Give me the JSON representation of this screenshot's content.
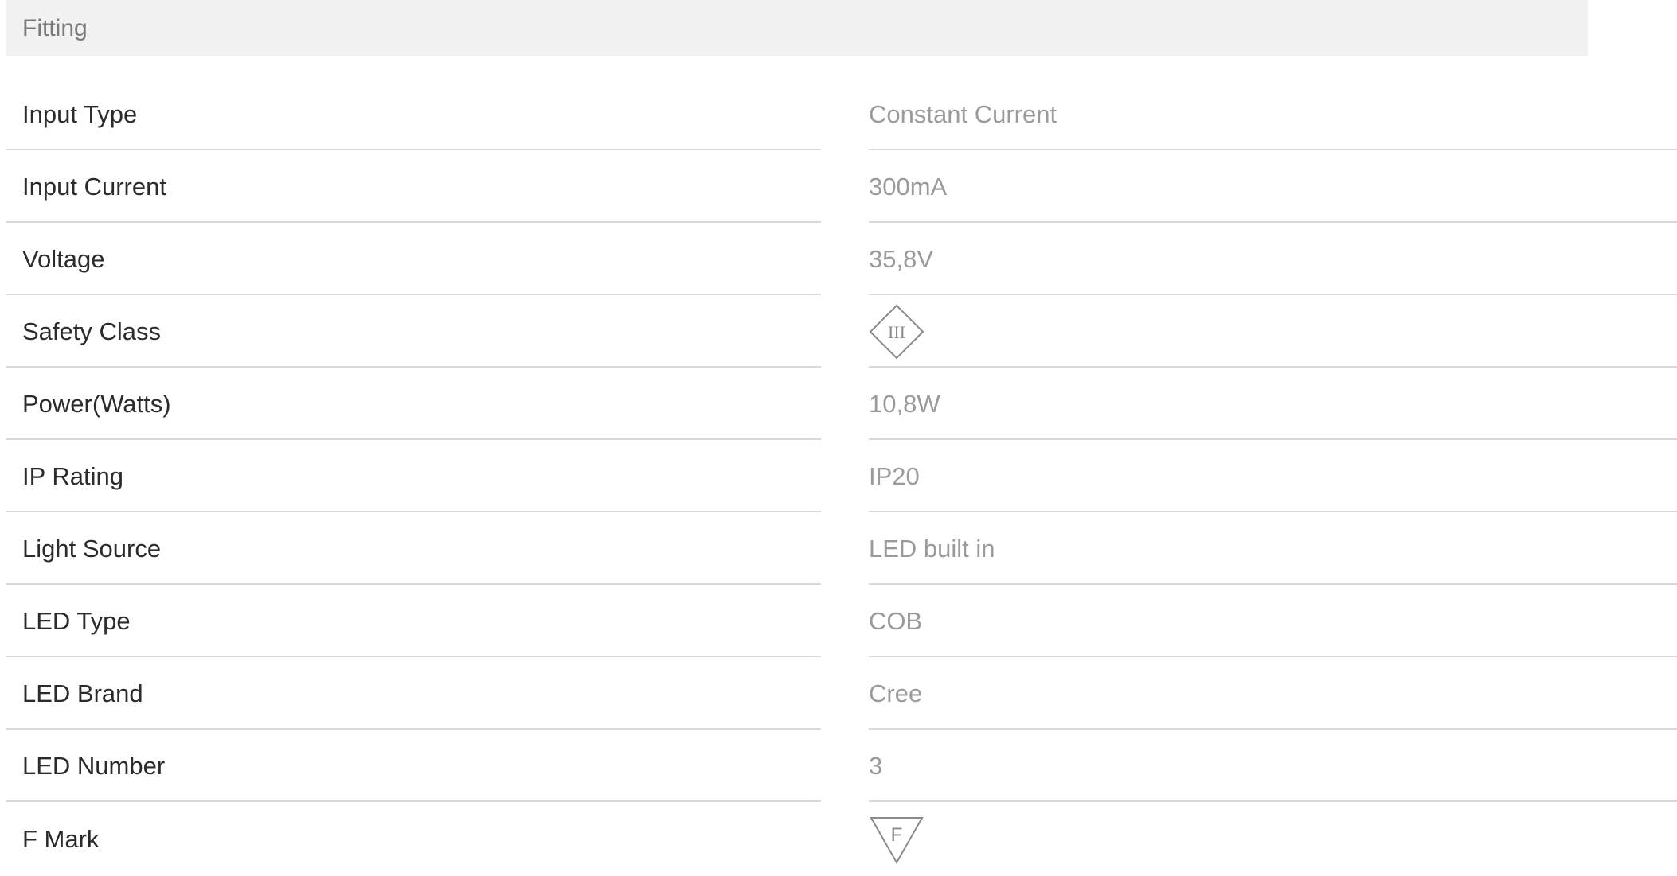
{
  "section": {
    "title": "Fitting"
  },
  "specs": [
    {
      "label": "Input Type",
      "value": "Constant Current"
    },
    {
      "label": "Input Current",
      "value": "300mA"
    },
    {
      "label": "Voltage",
      "value": "35,8V"
    },
    {
      "label": "Safety Class",
      "value": "",
      "icon": "safety-class-iii-icon",
      "icon_text": "III"
    },
    {
      "label": "Power(Watts)",
      "value": "10,8W"
    },
    {
      "label": "IP Rating",
      "value": "IP20"
    },
    {
      "label": "Light Source",
      "value": "LED built in"
    },
    {
      "label": "LED Type",
      "value": "COB"
    },
    {
      "label": "LED Brand",
      "value": "Cree"
    },
    {
      "label": "LED Number",
      "value": "3"
    },
    {
      "label": "F Mark",
      "value": "",
      "icon": "f-mark-icon",
      "icon_text": "F"
    }
  ],
  "colors": {
    "header_background": "#f1f1f1",
    "header_text": "#7a7a7a",
    "label_text": "#2b2b2b",
    "value_text": "#9a9a9a",
    "divider": "#d8d8d8",
    "icon_stroke": "#8a8a8a"
  }
}
